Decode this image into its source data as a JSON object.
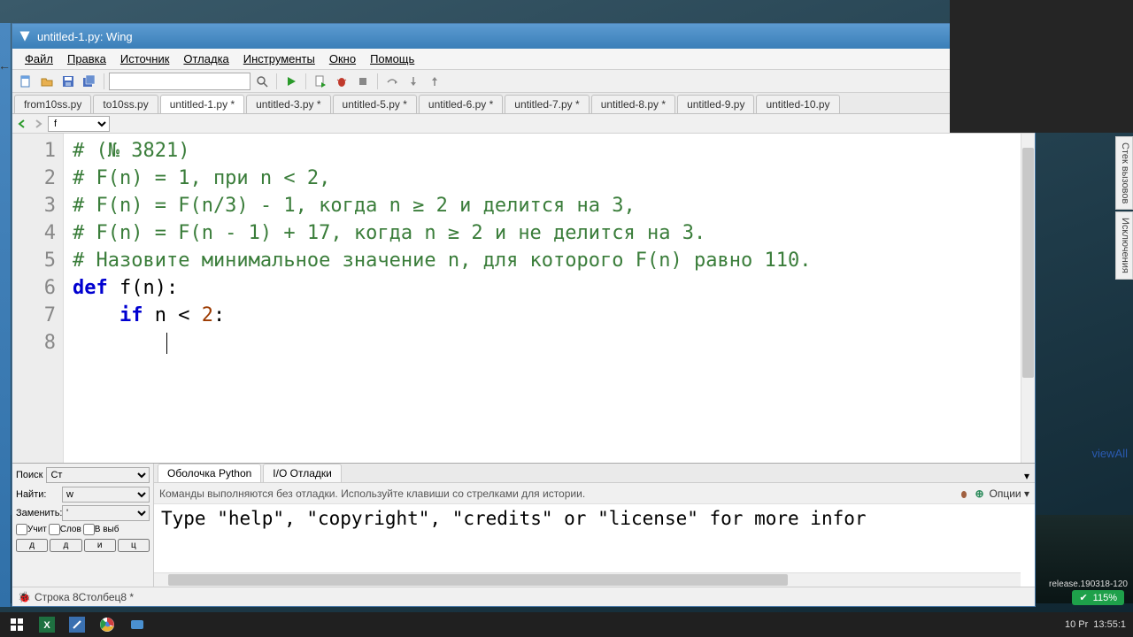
{
  "window": {
    "title": "untitled-1.py: Wing"
  },
  "menu": [
    "Файл",
    "Правка",
    "Источник",
    "Отладка",
    "Инструменты",
    "Окно",
    "Помощь"
  ],
  "toolbar": {
    "search_value": ""
  },
  "tabs": [
    "from10ss.py",
    "to10ss.py",
    "untitled-1.py *",
    "untitled-3.py *",
    "untitled-5.py *",
    "untitled-6.py *",
    "untitled-7.py *",
    "untitled-8.py *",
    "untitled-9.py",
    "untitled-10.py"
  ],
  "active_tab": 2,
  "navbar": {
    "symbol": "f"
  },
  "code": {
    "lines": [
      {
        "n": "1",
        "type": "comment",
        "text": "# (№ 3821)"
      },
      {
        "n": "2",
        "type": "comment",
        "text": "# F(n) = 1, при n < 2,"
      },
      {
        "n": "3",
        "type": "comment",
        "text": "# F(n) = F(n/3) - 1, когда n ≥ 2 и делится на 3,"
      },
      {
        "n": "4",
        "type": "comment",
        "text": "# F(n) = F(n - 1) + 17, когда n ≥ 2 и не делится на 3."
      },
      {
        "n": "5",
        "type": "comment",
        "text": "# Назовите минимальное значение n, для которого F(n) равно 110."
      },
      {
        "n": "6",
        "type": "def"
      },
      {
        "n": "7",
        "type": "if"
      },
      {
        "n": "8",
        "type": "cursor"
      }
    ],
    "def_kw": "def",
    "def_name": "f",
    "def_rest": "(n):",
    "if_kw": "if",
    "if_body": " n < ",
    "if_num": "2",
    "if_end": ":"
  },
  "side_tabs": [
    "Стек вызовов",
    "Исключения"
  ],
  "search_panel": {
    "title": "Поиск",
    "mode": "Ст",
    "find_label": "Найти:",
    "find_value": "w",
    "replace_label": "Заменить:",
    "replace_value": "'",
    "checks": [
      "Учит",
      "Слов",
      "В выб"
    ],
    "buttons": [
      "д",
      "д",
      "и",
      "ц"
    ]
  },
  "shell": {
    "tabs": [
      "Оболочка Python",
      "I/O Отладки"
    ],
    "active_tab": 0,
    "hint": "Команды выполняются без отладки.  Используйте клавиши со стрелками для истории.",
    "options": "Опции",
    "body": "   Type \"help\", \"copyright\", \"credits\" or \"license\" for more infor"
  },
  "status": {
    "text": "Строка 8Столбец8 *"
  },
  "overlay": {
    "link": "viewAll"
  },
  "tray": {
    "pct": "115%",
    "text": "release.190318-120",
    "time": "13:55:1"
  },
  "os_hint": "10 Pr"
}
